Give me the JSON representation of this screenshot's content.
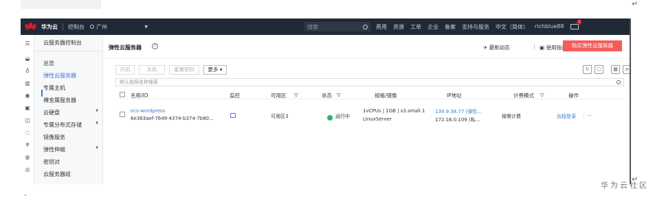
{
  "topbar": {
    "brand": "华为云",
    "console": "控制台",
    "region": "广州",
    "search_placeholder": "搜索",
    "menu": [
      "费用",
      "资源",
      "工单",
      "企业",
      "备案",
      "支持与服务",
      "中文（简体）",
      "richblue88"
    ],
    "notifications": "1"
  },
  "sidebar": {
    "title": "云服务器控制台",
    "items": [
      {
        "label": "总览",
        "arrow": ""
      },
      {
        "label": "弹性云服务器",
        "arrow": "",
        "active": true
      },
      {
        "label": "专属主机",
        "arrow": ""
      },
      {
        "label": "裸金属服务器",
        "arrow": ""
      },
      {
        "label": "云硬盘",
        "arrow": "▼"
      },
      {
        "label": "专属分布式存储",
        "arrow": "▼"
      },
      {
        "label": "镜像服务",
        "arrow": ""
      },
      {
        "label": "弹性伸缩",
        "arrow": "▼"
      },
      {
        "label": "密钥对",
        "arrow": ""
      },
      {
        "label": "云服务器组",
        "arrow": ""
      }
    ]
  },
  "header": {
    "title": "弹性云服务器",
    "latest_news": "最新动态",
    "guide": "使用指南",
    "buy_button": "购买弹性云服务器"
  },
  "toolbar": {
    "start": "开机",
    "stop": "关机",
    "reset_password": "重置密码",
    "more": "更多 ▾",
    "search_placeholder": "默认按照名称搜索"
  },
  "table": {
    "columns": [
      "名称/ID",
      "监控",
      "可用区",
      "状态",
      "规格/镜像",
      "IP地址",
      "计费模式",
      "操作"
    ],
    "rows": [
      {
        "name": "ecs-wordpress",
        "id": "6e363aef-7649-4374-b374-7b80...",
        "zone": "可用区3",
        "status": "运行中",
        "spec": "1vCPUs | 1GB | s3.small.1",
        "image": "LinuxServer",
        "ip_public": "139.9.38.77 (弹性...",
        "ip_private": "172.16.0.109 (私...",
        "billing": "按需计费",
        "action": "远程登录",
        "action_more": "..."
      }
    ]
  },
  "watermark": "华为云社区"
}
